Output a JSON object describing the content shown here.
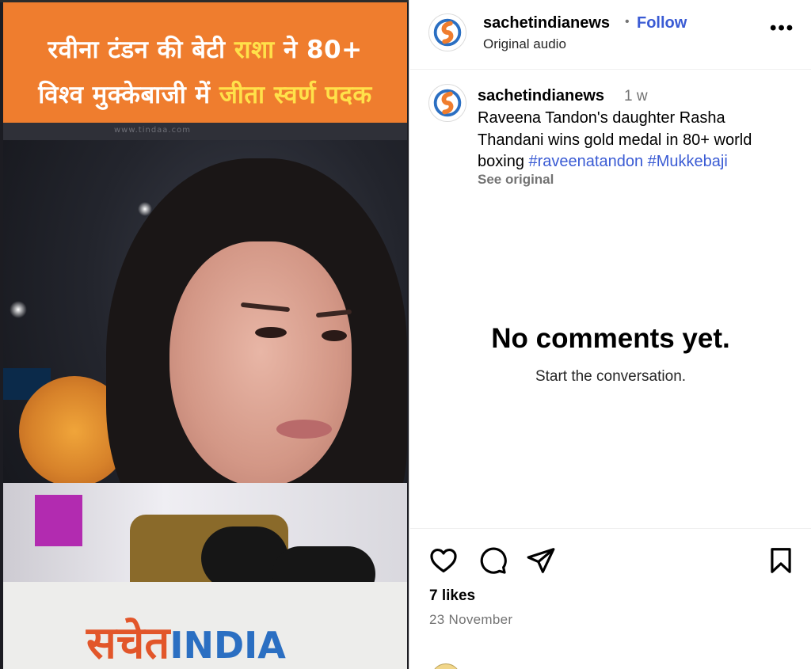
{
  "media": {
    "banner_line1_a": "रवीना टंडन की बेटी ",
    "banner_line1_highlight": "राशा",
    "banner_line1_b": " ने 80+",
    "banner_line2_a": "विश्व मुक्केबाजी में ",
    "banner_line2_highlight": "जीता स्वर्ण पदक",
    "watermark_text": "www.tindaa.com",
    "brand_hi": "सचेत",
    "brand_en": "INDIA",
    "colors": {
      "banner": "#ef7d2e",
      "highlight": "#ffe14a",
      "brand_hi": "#e2562a",
      "brand_en": "#2b6fc2"
    }
  },
  "header": {
    "username": "sachetindianews",
    "separator": "•",
    "follow_label": "Follow",
    "audio_label": "Original audio",
    "more_label": "•••"
  },
  "caption": {
    "username": "sachetindianews",
    "time": "1 w",
    "text": "Raveena Tandon's daughter Rasha Thandani wins gold medal in 80+ world boxing",
    "hashtag1": "#raveenatandon",
    "hashtag2": "#Mukkebaji",
    "see_original": "See original"
  },
  "comments": {
    "empty_title": "No comments yet.",
    "empty_subtitle": "Start the conversation."
  },
  "actions": {
    "icons": [
      "heart-icon",
      "comment-icon",
      "share-icon",
      "bookmark-icon"
    ],
    "likes": "7 likes",
    "date": "23 November"
  },
  "theme": {
    "link": "#3a5bd4",
    "muted": "#737373"
  }
}
